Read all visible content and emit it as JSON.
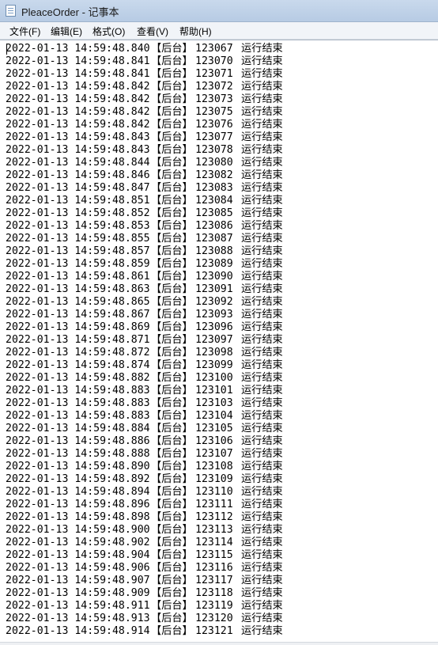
{
  "window": {
    "title": "PleaceOrder - 记事本"
  },
  "menu": [
    {
      "label": "文件(F)"
    },
    {
      "label": "编辑(E)"
    },
    {
      "label": "格式(O)"
    },
    {
      "label": "查看(V)"
    },
    {
      "label": "帮助(H)"
    }
  ],
  "log_lines": [
    {
      "timestamp": "2022-01-13 14:59:48.840",
      "tag": "【后台】",
      "id": "123067",
      "status": "运行结束"
    },
    {
      "timestamp": "2022-01-13 14:59:48.841",
      "tag": "【后台】",
      "id": "123070",
      "status": "运行结束"
    },
    {
      "timestamp": "2022-01-13 14:59:48.841",
      "tag": "【后台】",
      "id": "123071",
      "status": "运行结束"
    },
    {
      "timestamp": "2022-01-13 14:59:48.842",
      "tag": "【后台】",
      "id": "123072",
      "status": "运行结束"
    },
    {
      "timestamp": "2022-01-13 14:59:48.842",
      "tag": "【后台】",
      "id": "123073",
      "status": "运行结束"
    },
    {
      "timestamp": "2022-01-13 14:59:48.842",
      "tag": "【后台】",
      "id": "123075",
      "status": "运行结束"
    },
    {
      "timestamp": "2022-01-13 14:59:48.842",
      "tag": "【后台】",
      "id": "123076",
      "status": "运行结束"
    },
    {
      "timestamp": "2022-01-13 14:59:48.843",
      "tag": "【后台】",
      "id": "123077",
      "status": "运行结束"
    },
    {
      "timestamp": "2022-01-13 14:59:48.843",
      "tag": "【后台】",
      "id": "123078",
      "status": "运行结束"
    },
    {
      "timestamp": "2022-01-13 14:59:48.844",
      "tag": "【后台】",
      "id": "123080",
      "status": "运行结束"
    },
    {
      "timestamp": "2022-01-13 14:59:48.846",
      "tag": "【后台】",
      "id": "123082",
      "status": "运行结束"
    },
    {
      "timestamp": "2022-01-13 14:59:48.847",
      "tag": "【后台】",
      "id": "123083",
      "status": "运行结束"
    },
    {
      "timestamp": "2022-01-13 14:59:48.851",
      "tag": "【后台】",
      "id": "123084",
      "status": "运行结束"
    },
    {
      "timestamp": "2022-01-13 14:59:48.852",
      "tag": "【后台】",
      "id": "123085",
      "status": "运行结束"
    },
    {
      "timestamp": "2022-01-13 14:59:48.853",
      "tag": "【后台】",
      "id": "123086",
      "status": "运行结束"
    },
    {
      "timestamp": "2022-01-13 14:59:48.855",
      "tag": "【后台】",
      "id": "123087",
      "status": "运行结束"
    },
    {
      "timestamp": "2022-01-13 14:59:48.857",
      "tag": "【后台】",
      "id": "123088",
      "status": "运行结束"
    },
    {
      "timestamp": "2022-01-13 14:59:48.859",
      "tag": "【后台】",
      "id": "123089",
      "status": "运行结束"
    },
    {
      "timestamp": "2022-01-13 14:59:48.861",
      "tag": "【后台】",
      "id": "123090",
      "status": "运行结束"
    },
    {
      "timestamp": "2022-01-13 14:59:48.863",
      "tag": "【后台】",
      "id": "123091",
      "status": "运行结束"
    },
    {
      "timestamp": "2022-01-13 14:59:48.865",
      "tag": "【后台】",
      "id": "123092",
      "status": "运行结束"
    },
    {
      "timestamp": "2022-01-13 14:59:48.867",
      "tag": "【后台】",
      "id": "123093",
      "status": "运行结束"
    },
    {
      "timestamp": "2022-01-13 14:59:48.869",
      "tag": "【后台】",
      "id": "123096",
      "status": "运行结束"
    },
    {
      "timestamp": "2022-01-13 14:59:48.871",
      "tag": "【后台】",
      "id": "123097",
      "status": "运行结束"
    },
    {
      "timestamp": "2022-01-13 14:59:48.872",
      "tag": "【后台】",
      "id": "123098",
      "status": "运行结束"
    },
    {
      "timestamp": "2022-01-13 14:59:48.874",
      "tag": "【后台】",
      "id": "123099",
      "status": "运行结束"
    },
    {
      "timestamp": "2022-01-13 14:59:48.882",
      "tag": "【后台】",
      "id": "123100",
      "status": "运行结束"
    },
    {
      "timestamp": "2022-01-13 14:59:48.883",
      "tag": "【后台】",
      "id": "123101",
      "status": "运行结束"
    },
    {
      "timestamp": "2022-01-13 14:59:48.883",
      "tag": "【后台】",
      "id": "123103",
      "status": "运行结束"
    },
    {
      "timestamp": "2022-01-13 14:59:48.883",
      "tag": "【后台】",
      "id": "123104",
      "status": "运行结束"
    },
    {
      "timestamp": "2022-01-13 14:59:48.884",
      "tag": "【后台】",
      "id": "123105",
      "status": "运行结束"
    },
    {
      "timestamp": "2022-01-13 14:59:48.886",
      "tag": "【后台】",
      "id": "123106",
      "status": "运行结束"
    },
    {
      "timestamp": "2022-01-13 14:59:48.888",
      "tag": "【后台】",
      "id": "123107",
      "status": "运行结束"
    },
    {
      "timestamp": "2022-01-13 14:59:48.890",
      "tag": "【后台】",
      "id": "123108",
      "status": "运行结束"
    },
    {
      "timestamp": "2022-01-13 14:59:48.892",
      "tag": "【后台】",
      "id": "123109",
      "status": "运行结束"
    },
    {
      "timestamp": "2022-01-13 14:59:48.894",
      "tag": "【后台】",
      "id": "123110",
      "status": "运行结束"
    },
    {
      "timestamp": "2022-01-13 14:59:48.896",
      "tag": "【后台】",
      "id": "123111",
      "status": "运行结束"
    },
    {
      "timestamp": "2022-01-13 14:59:48.898",
      "tag": "【后台】",
      "id": "123112",
      "status": "运行结束"
    },
    {
      "timestamp": "2022-01-13 14:59:48.900",
      "tag": "【后台】",
      "id": "123113",
      "status": "运行结束"
    },
    {
      "timestamp": "2022-01-13 14:59:48.902",
      "tag": "【后台】",
      "id": "123114",
      "status": "运行结束"
    },
    {
      "timestamp": "2022-01-13 14:59:48.904",
      "tag": "【后台】",
      "id": "123115",
      "status": "运行结束"
    },
    {
      "timestamp": "2022-01-13 14:59:48.906",
      "tag": "【后台】",
      "id": "123116",
      "status": "运行结束"
    },
    {
      "timestamp": "2022-01-13 14:59:48.907",
      "tag": "【后台】",
      "id": "123117",
      "status": "运行结束"
    },
    {
      "timestamp": "2022-01-13 14:59:48.909",
      "tag": "【后台】",
      "id": "123118",
      "status": "运行结束"
    },
    {
      "timestamp": "2022-01-13 14:59:48.911",
      "tag": "【后台】",
      "id": "123119",
      "status": "运行结束"
    },
    {
      "timestamp": "2022-01-13 14:59:48.913",
      "tag": "【后台】",
      "id": "123120",
      "status": "运行结束"
    },
    {
      "timestamp": "2022-01-13 14:59:48.914",
      "tag": "【后台】",
      "id": "123121",
      "status": "运行结束"
    }
  ]
}
